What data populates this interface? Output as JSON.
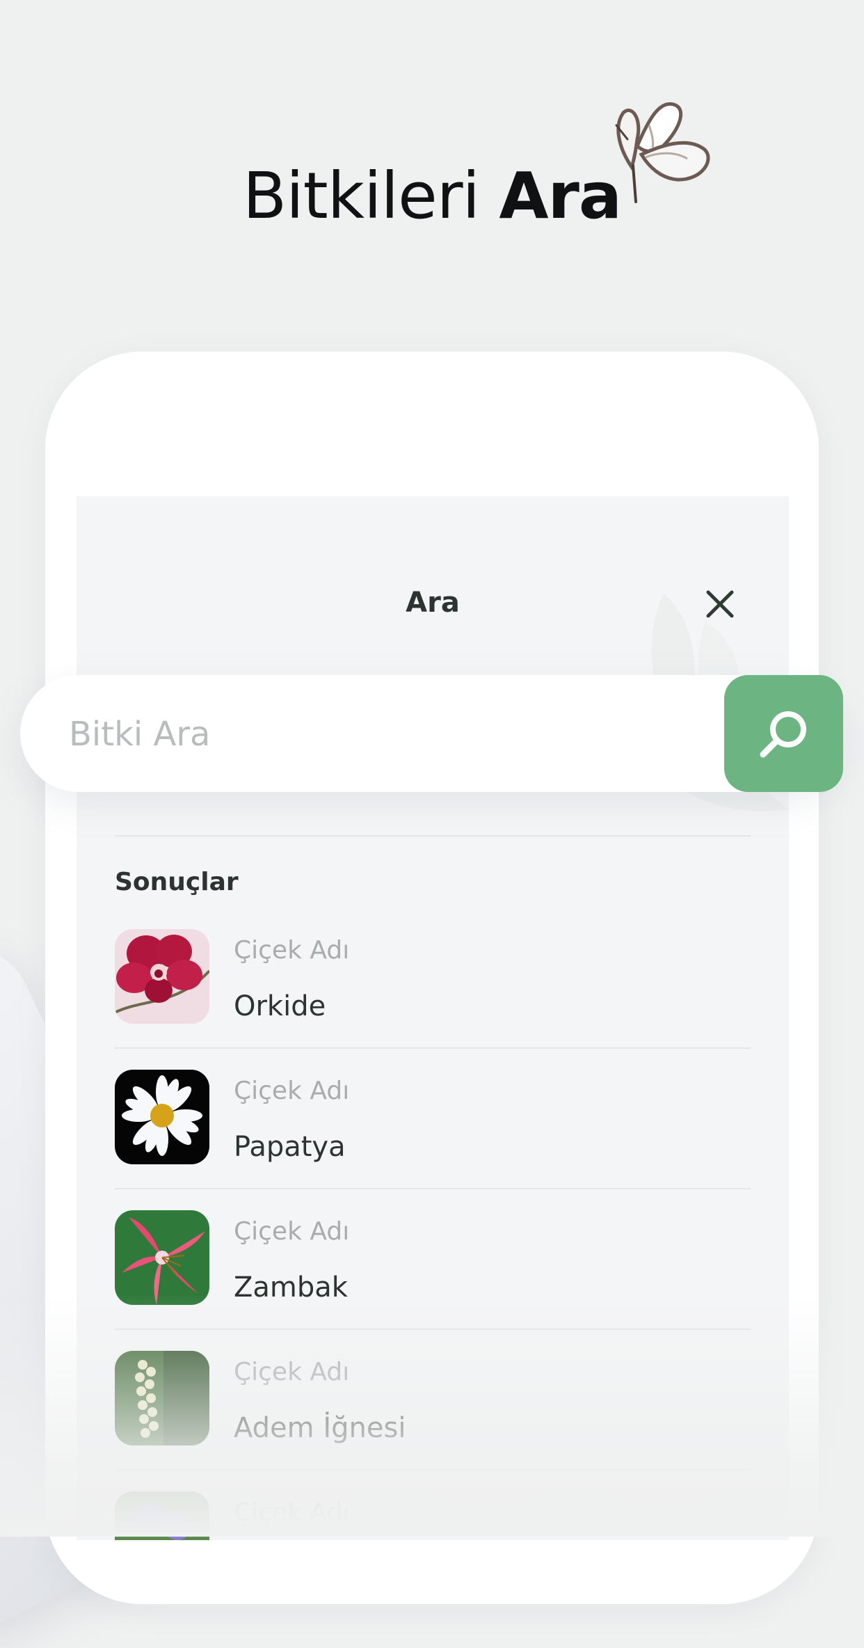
{
  "headline": {
    "light": "Bitkileri",
    "bold": "Ara"
  },
  "screen": {
    "title": "Ara"
  },
  "search": {
    "placeholder": "Bitki Ara",
    "value": ""
  },
  "results": {
    "heading": "Sonuçlar",
    "items": [
      {
        "label": "Çiçek Adı",
        "name": "Orkide",
        "icon": "orchid-image"
      },
      {
        "label": "Çiçek Adı",
        "name": "Papatya",
        "icon": "daisy-image"
      },
      {
        "label": "Çiçek Adı",
        "name": "Zambak",
        "icon": "lily-image"
      },
      {
        "label": "Çiçek Adı",
        "name": "Adem İğnesi",
        "icon": "adams-needle-image"
      },
      {
        "label": "Çiçek Adı",
        "name": "",
        "icon": "flower-image"
      }
    ]
  },
  "colors": {
    "accent": "#6cb582",
    "background": "#eff0f0",
    "text": "#2d3330",
    "muted": "#a9acad"
  }
}
